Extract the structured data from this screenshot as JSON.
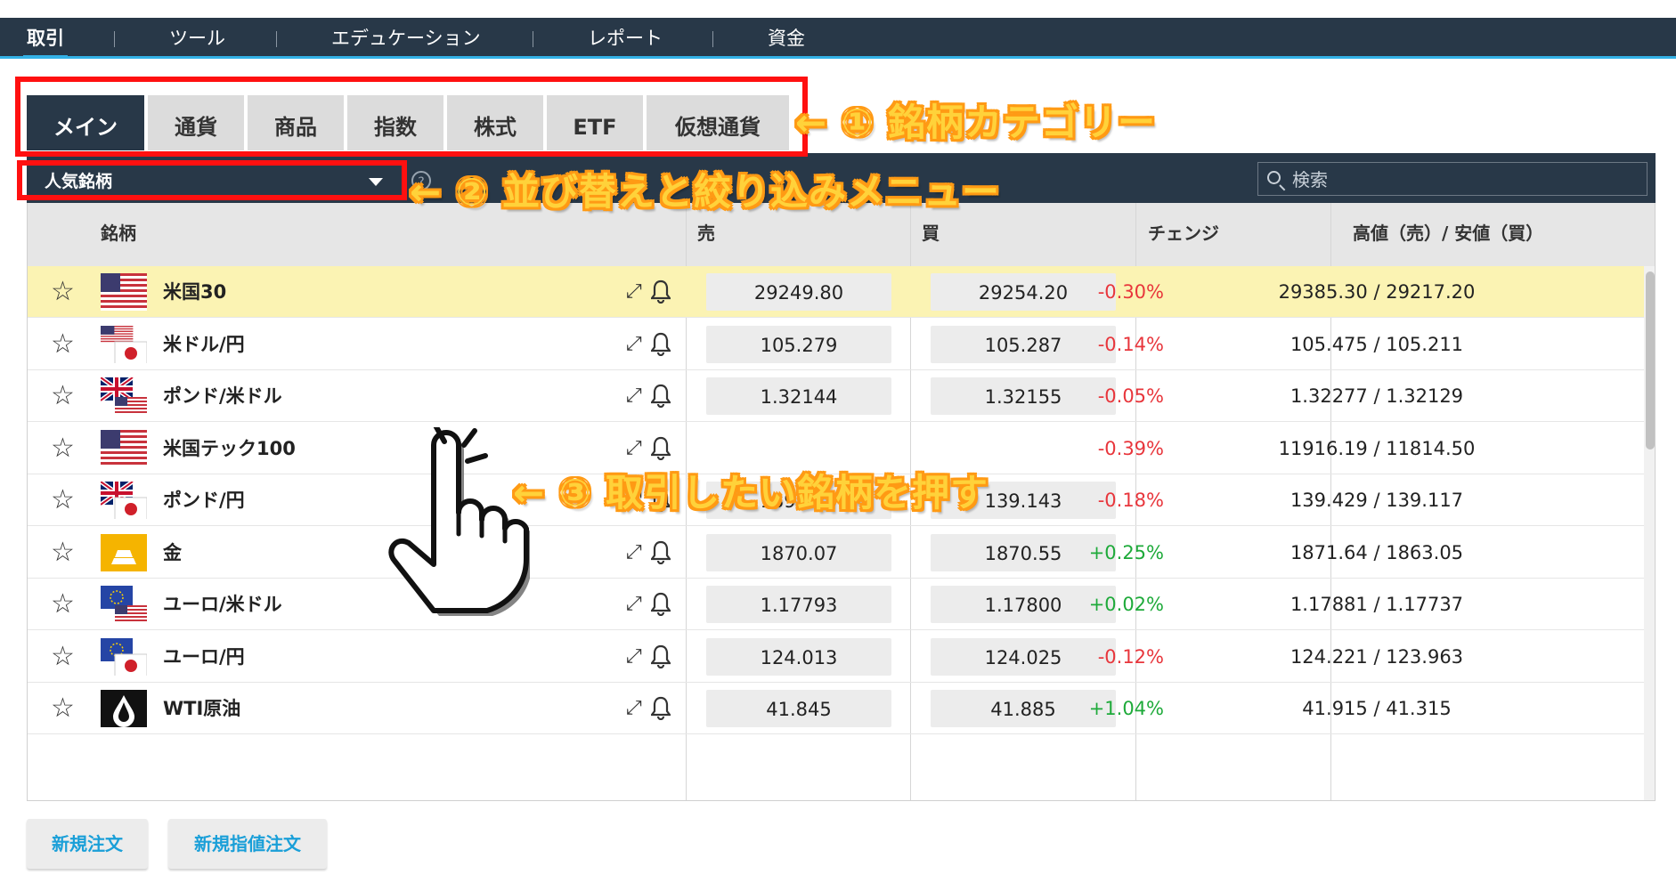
{
  "nav": {
    "items": [
      {
        "label": "取引",
        "active": true
      },
      {
        "label": "ツール"
      },
      {
        "label": "エデュケーション"
      },
      {
        "label": "レポート"
      },
      {
        "label": "資金"
      }
    ]
  },
  "tabs": [
    {
      "label": "メイン",
      "active": true
    },
    {
      "label": "通貨"
    },
    {
      "label": "商品"
    },
    {
      "label": "指数"
    },
    {
      "label": "株式"
    },
    {
      "label": "ETF"
    },
    {
      "label": "仮想通貨"
    }
  ],
  "filter": {
    "dropdown_value": "人気銘柄",
    "help": "?",
    "search_placeholder": "検索"
  },
  "table": {
    "headers": {
      "symbol": "銘柄",
      "sell": "売",
      "buy": "買",
      "change": "チェンジ",
      "highlow": "高値（売）/ 安値（買）"
    },
    "rows": [
      {
        "name": "米国30",
        "flag": "us",
        "sell": "29249.80",
        "buy": "29254.20",
        "change": "-0.30%",
        "dir": "neg",
        "highlow": "29385.30 / 29217.20",
        "highlighted": true
      },
      {
        "name": "米ドル/円",
        "flag": "us-jp",
        "sell": "105.279",
        "buy": "105.287",
        "change": "-0.14%",
        "dir": "neg",
        "highlow": "105.475 / 105.211"
      },
      {
        "name": "ポンド/米ドル",
        "flag": "uk-us",
        "sell": "1.32144",
        "buy": "1.32155",
        "change": "-0.05%",
        "dir": "neg",
        "highlow": "1.32277 / 1.32129"
      },
      {
        "name": "米国テック100",
        "flag": "us",
        "sell": "",
        "buy": "",
        "change": "-0.39%",
        "dir": "neg",
        "highlow": "11916.19 / 11814.50"
      },
      {
        "name": "ポンド/円",
        "flag": "uk-jp",
        "sell": "139.120",
        "buy": "139.143",
        "change": "-0.18%",
        "dir": "neg",
        "highlow": "139.429 / 139.117"
      },
      {
        "name": "金",
        "flag": "gold",
        "sell": "1870.07",
        "buy": "1870.55",
        "change": "+0.25%",
        "dir": "pos",
        "highlow": "1871.64 / 1863.05"
      },
      {
        "name": "ユーロ/米ドル",
        "flag": "eu-us",
        "sell": "1.17793",
        "buy": "1.17800",
        "change": "+0.02%",
        "dir": "pos",
        "highlow": "1.17881 / 1.17737"
      },
      {
        "name": "ユーロ/円",
        "flag": "eu-jp",
        "sell": "124.013",
        "buy": "124.025",
        "change": "-0.12%",
        "dir": "neg",
        "highlow": "124.221 / 123.963"
      },
      {
        "name": "WTI原油",
        "flag": "oil",
        "sell": "41.845",
        "buy": "41.885",
        "change": "+1.04%",
        "dir": "pos",
        "highlow": "41.915 / 41.315"
      }
    ]
  },
  "buttons": {
    "new_order": "新規注文",
    "new_limit_order": "新規指値注文"
  },
  "annotations": {
    "a1": "← ① 銘柄カテゴリー",
    "a2": "← ② 並び替えと絞り込みメニュー",
    "a3": "← ③ 取引したい銘柄を押す"
  },
  "colors": {
    "nav_bg": "#283848",
    "accent": "#33b1e6",
    "negative": "#e8363c",
    "positive": "#1eaa3a",
    "highlight_row": "#fbf3b3",
    "annotation_red": "#ff1010",
    "annotation_text": "#ffd23a"
  },
  "icons": {
    "star": "star-outline-icon",
    "expand": "expand-icon",
    "bell": "bell-icon",
    "search": "search-icon",
    "caret": "caret-down-icon"
  }
}
